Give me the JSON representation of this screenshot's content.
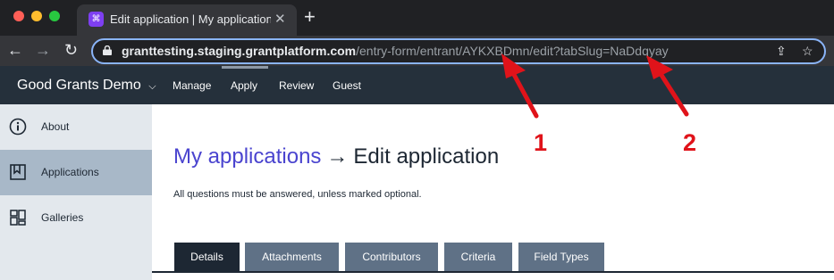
{
  "browser": {
    "tab_title": "Edit application | My applications",
    "tab_icon": "grid-logo-icon",
    "address": {
      "host": "granttesting.staging.grantplatform.com",
      "path": "/entry-form/entrant/AYKXBDmn/edit?tabSlug=NaDdqyay"
    }
  },
  "app": {
    "brand": "Good Grants Demo",
    "menu": [
      "Manage",
      "Apply",
      "Review",
      "Guest"
    ]
  },
  "sidebar": {
    "items": [
      {
        "label": "About",
        "icon": "info-icon"
      },
      {
        "label": "Applications",
        "icon": "bookmark-icon",
        "active": true
      },
      {
        "label": "Galleries",
        "icon": "gallery-icon"
      }
    ]
  },
  "main": {
    "breadcrumb": "My applications",
    "arrow": "→",
    "title": "Edit application",
    "note": "All questions must be answered, unless marked optional.",
    "tabs": [
      "Details",
      "Attachments",
      "Contributors",
      "Criteria",
      "Field Types"
    ]
  },
  "annotations": [
    "1",
    "2"
  ],
  "colors": {
    "annotation": "#e0131a",
    "appbar": "#25303b",
    "link": "#4a44cf"
  }
}
